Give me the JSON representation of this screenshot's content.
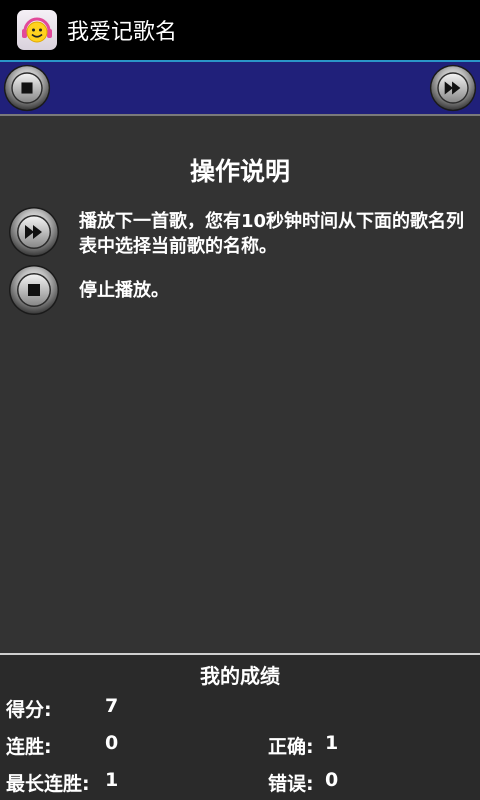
{
  "app": {
    "title": "我爱记歌名",
    "icon": "smiley-headphones-icon"
  },
  "controls": {
    "stop_icon": "stop-icon",
    "next_icon": "fast-forward-icon",
    "bar_color": "#20207a"
  },
  "instructions": {
    "title": "操作说明",
    "items": [
      {
        "icon": "fast-forward-icon",
        "text": "播放下一首歌，您有10秒钟时间从下面的歌名列表中选择当前歌的名称。"
      },
      {
        "icon": "stop-icon",
        "text": "停止播放。"
      }
    ]
  },
  "score": {
    "title": "我的成绩",
    "score_label": "得分:",
    "score_value": "7",
    "streak_label": "连胜:",
    "streak_value": "0",
    "correct_label": "正确:",
    "correct_value": "1",
    "longest_streak_label": "最长连胜:",
    "longest_streak_value": "1",
    "wrong_label": "错误:",
    "wrong_value": "0"
  }
}
